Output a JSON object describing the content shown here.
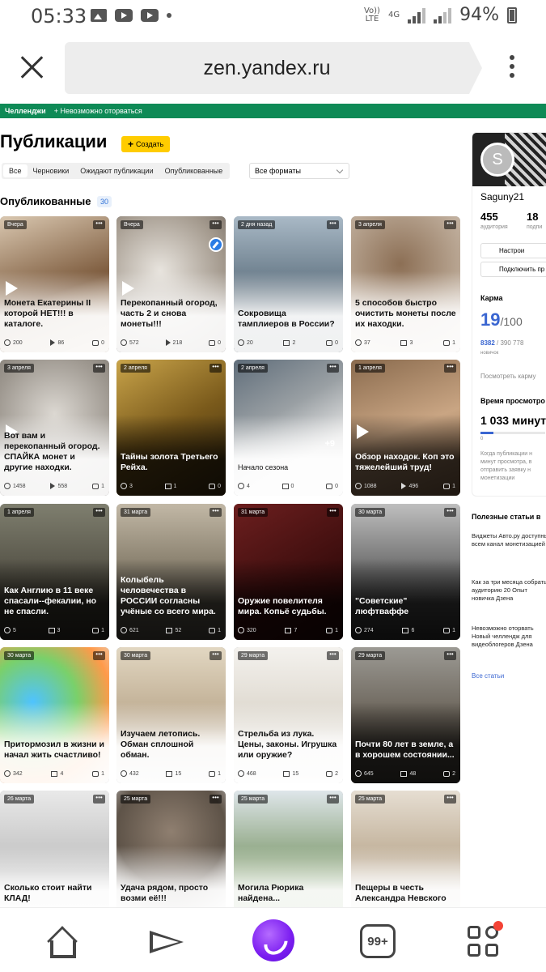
{
  "status_bar": {
    "time": "05:33",
    "network": "4G",
    "volte_top": "Vo))",
    "volte_bottom": "LTE",
    "battery": "94%"
  },
  "browser": {
    "url": "zen.yandex.ru"
  },
  "challenge_strip": {
    "label": "Челленджи",
    "item": "+ Невозможно оторваться"
  },
  "page": {
    "title": "Публикации",
    "create_label": "Создать",
    "filters": [
      "Все",
      "Черновики",
      "Ожидают публикации",
      "Опубликованные"
    ],
    "format_select": "Все форматы",
    "published_label": "Опубликованные",
    "published_count": "30"
  },
  "cards": [
    {
      "date": "Вчера",
      "title": "Монета Екатерины II которой НЕТ!!! в каталоге.",
      "stats": [
        "200",
        "86",
        "0"
      ],
      "video": true
    },
    {
      "date": "Вчера",
      "title": "Перекопанный огород, часть 2 и снова монеты!!!",
      "stats": [
        "572",
        "218",
        "0"
      ],
      "video": true
    },
    {
      "date": "2 дня назад",
      "title": "Сокровища тамплиеров в России?",
      "stats": [
        "20",
        "2",
        "0"
      ]
    },
    {
      "date": "3 апреля",
      "title": "5 способов быстро очистить монеты после их находки.",
      "stats": [
        "37",
        "3",
        "1"
      ]
    },
    {
      "date": "3 апреля",
      "title": "Вот вам и перекопанный огород. СПАЙКА монет и другие находки.",
      "stats": [
        "1458",
        "558",
        "1"
      ],
      "video": true
    },
    {
      "date": "2 апреля",
      "title": "Тайны золота Третьего Рейха.",
      "stats": [
        "3",
        "1",
        "0"
      ]
    },
    {
      "date": "2 апреля",
      "title": "Начало сезона",
      "stats": [
        "4",
        "0",
        "0"
      ],
      "extra": "+9"
    },
    {
      "date": "1 апреля",
      "title": "Обзор находок. Коп это тяжелейший труд!",
      "stats": [
        "1088",
        "496",
        "1"
      ],
      "video": true
    },
    {
      "date": "1 апреля",
      "title": "Как Англию в 11 веке спасали--фекалии, но не спасли.",
      "stats": [
        "5",
        "3",
        "1"
      ]
    },
    {
      "date": "31 марта",
      "title": "Колыбель человечества в РОССИИ согласны учёные со всего мира.",
      "stats": [
        "621",
        "52",
        "1"
      ]
    },
    {
      "date": "31 марта",
      "title": "Оружие повелителя мира. Копьё судьбы.",
      "stats": [
        "320",
        "7",
        "1"
      ]
    },
    {
      "date": "30 марта",
      "title": "\"Советские\" люфтваффе",
      "stats": [
        "274",
        "6",
        "1"
      ]
    },
    {
      "date": "30 марта",
      "title": "Притормозил в жизни и начал жить счастливо!",
      "stats": [
        "342",
        "4",
        "1"
      ]
    },
    {
      "date": "30 марта",
      "title": "Изучаем летопись. Обман сплошной обман.",
      "stats": [
        "432",
        "15",
        "1"
      ]
    },
    {
      "date": "29 марта",
      "title": "Стрельба из лука. Цены, законы. Игрушка или оружие?",
      "stats": [
        "468",
        "15",
        "2"
      ]
    },
    {
      "date": "29 марта",
      "title": "Почти 80 лет в земле, а в хорошем состоянии...",
      "stats": [
        "645",
        "48",
        "2"
      ]
    },
    {
      "date": "26 марта",
      "title": "Сколько стоит найти КЛАД!"
    },
    {
      "date": "25 марта",
      "title": "Удача рядом, просто возми её!!!"
    },
    {
      "date": "25 марта",
      "title": "Могила Рюрика найдена..."
    },
    {
      "date": "25 марта",
      "title": "Пещеры в честь Александра Невского"
    }
  ],
  "sidebar": {
    "avatar_letter": "S",
    "name": "Saguny21",
    "audience_value": "455",
    "audience_label": "аудитория",
    "subs_value": "18",
    "subs_label": "подпи",
    "settings_button": "Настрои",
    "connect_button": "Подключить пр",
    "karma_title": "Карма",
    "karma_value": "19",
    "karma_max": "/100",
    "karma_progress": "8382",
    "karma_total": "/ 390 778",
    "karma_level": "новичок",
    "karma_link": "Посмотреть карму",
    "views_title": "Время просмотро",
    "views_value": "1 033 минут",
    "views_zero": "0",
    "views_note": "Когда публикации н минут просмотра, в отправить заявку н монетизации",
    "useful_title": "Полезные статьи в",
    "useful_items": [
      "Виджеты Авто.ру доступны всем канал монетизацией",
      "Как за три месяца собрать аудиторию 20 Опыт новичка Дзена",
      "Невозможно оторвать Новый челлендж для видеоблогеров Дзена"
    ],
    "all_articles": "Все статьи"
  },
  "bottom_nav": {
    "notifications": "99+"
  },
  "colors": {
    "accent_green": "#0e8a56",
    "create_yellow": "#ffcc00",
    "link_blue": "#3a66d1",
    "alice_purple": "#7a1cf0"
  }
}
